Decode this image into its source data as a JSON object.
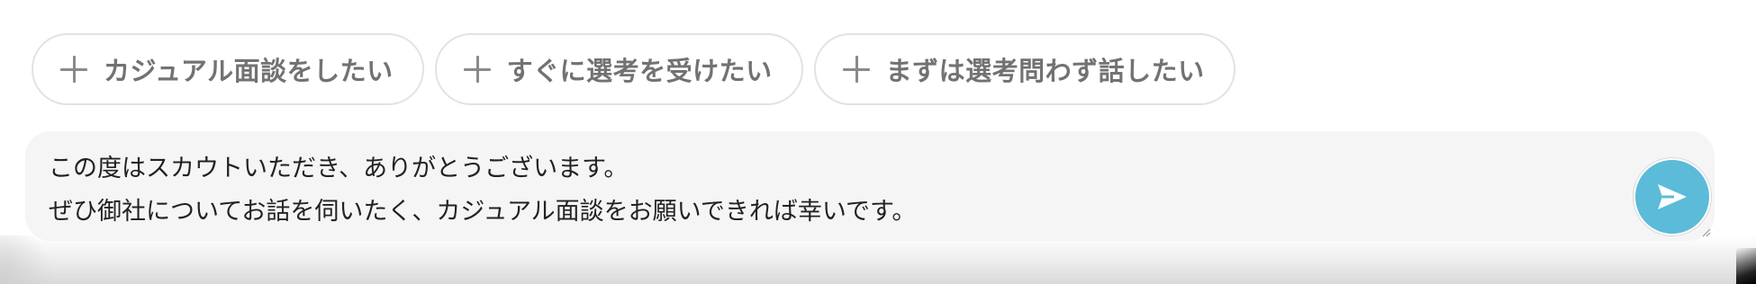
{
  "suggestions": [
    {
      "label": "カジュアル面談をしたい",
      "icon": "plus-icon"
    },
    {
      "label": "すぐに選考を受けたい",
      "icon": "plus-icon"
    },
    {
      "label": "まずは選考問わず話したい",
      "icon": "plus-icon"
    }
  ],
  "composer": {
    "message_line1": "この度はスカウトいただき、ありがとうございます。",
    "message_line2": "ぜひ御社についてお話を伺いたく、カジュアル面談をお願いできれば幸いです。",
    "send_icon": "send-icon",
    "send_color": "#5bbbd8"
  }
}
